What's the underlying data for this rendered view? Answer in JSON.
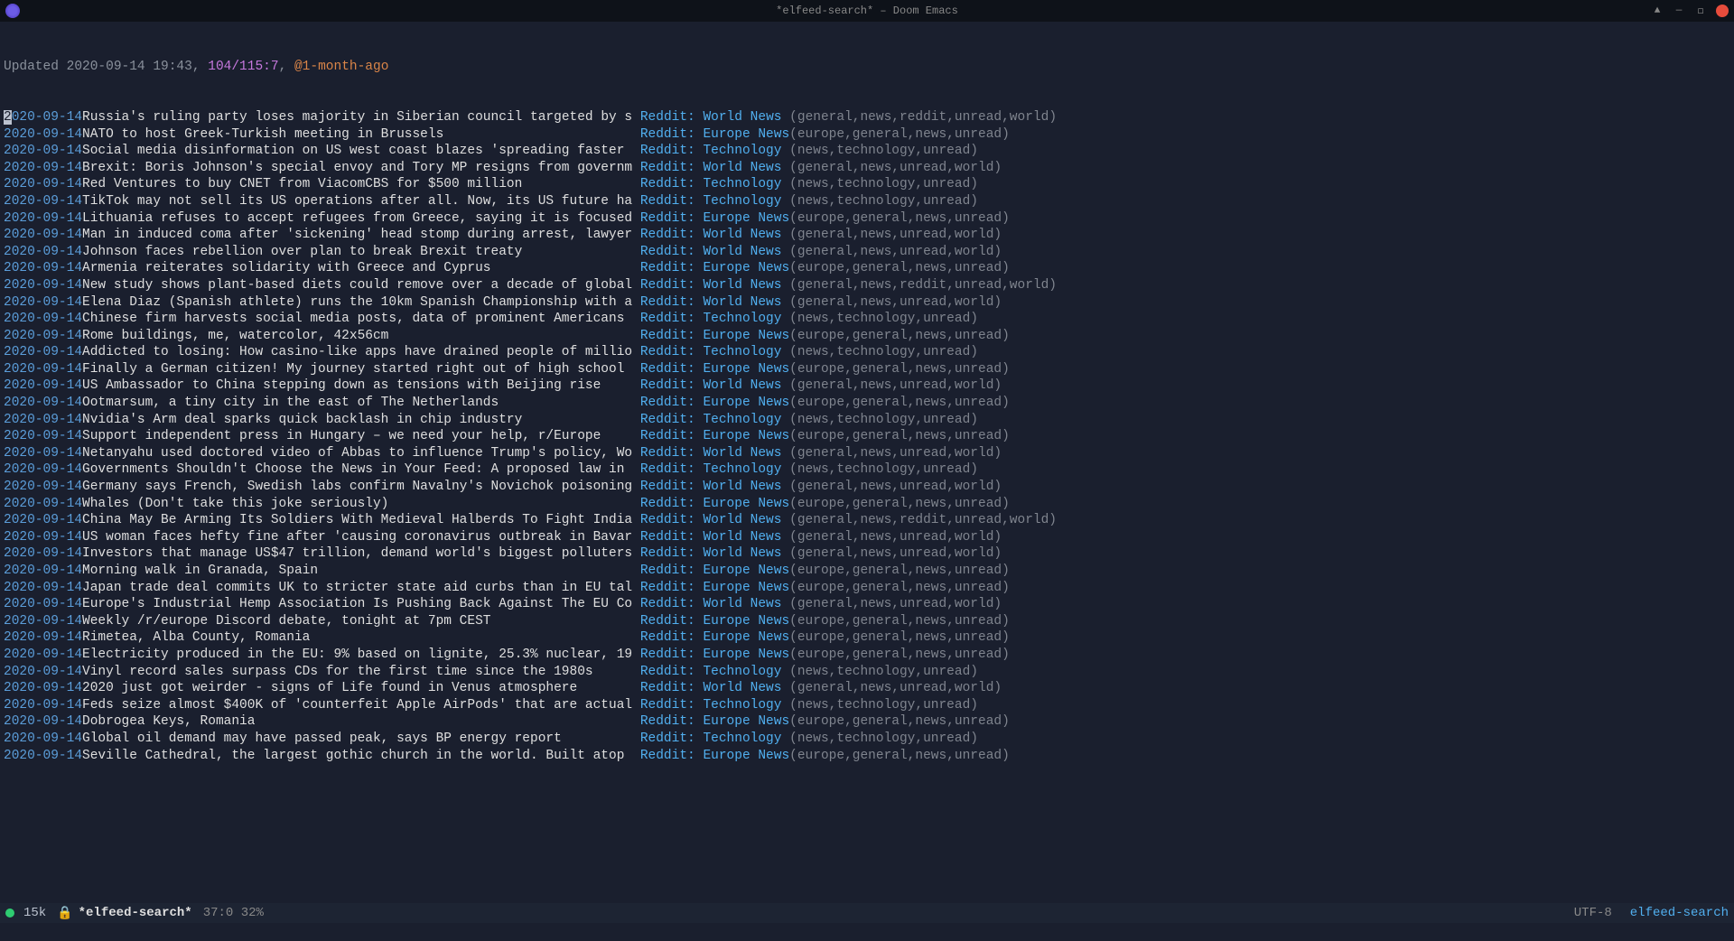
{
  "titlebar": {
    "title": "*elfeed-search* – Doom Emacs"
  },
  "header": {
    "updated": "Updated 2020-09-14 19:43, ",
    "count": "104/115:7",
    "sep": ", ",
    "filter": "@1-month-ago"
  },
  "feeds": {
    "world": "Reddit: World News",
    "europe": "Reddit: Europe News",
    "tech": "Reddit: Technology"
  },
  "tag_strings": {
    "world_reddit": "(general,news,reddit,unread,world)",
    "world": "(general,news,unread,world)",
    "europe": "(europe,general,news,unread)",
    "tech": "(news,technology,unread)"
  },
  "date": "2020-09-14",
  "entries": [
    {
      "cursor": true,
      "title": "Russia's ruling party loses majority in Siberian council targeted by s",
      "feed": "world",
      "tags": "world_reddit"
    },
    {
      "title": "NATO to host Greek-Turkish meeting in Brussels",
      "feed": "europe",
      "tags": "europe"
    },
    {
      "title": "Social media disinformation on US west coast blazes 'spreading faster",
      "feed": "tech",
      "tags": "tech"
    },
    {
      "title": "Brexit: Boris Johnson's special envoy and Tory MP resigns from governm",
      "feed": "world",
      "tags": "world"
    },
    {
      "title": "Red Ventures to buy CNET from ViacomCBS for $500 million",
      "feed": "tech",
      "tags": "tech"
    },
    {
      "title": "TikTok may not sell its US operations after all. Now, its US future ha",
      "feed": "tech",
      "tags": "tech"
    },
    {
      "title": "Lithuania refuses to accept refugees from Greece, saying it is focused",
      "feed": "europe",
      "tags": "europe"
    },
    {
      "title": "Man in induced coma after 'sickening' head stomp during arrest, lawyer",
      "feed": "world",
      "tags": "world"
    },
    {
      "title": "Johnson faces rebellion over plan to break Brexit treaty",
      "feed": "world",
      "tags": "world"
    },
    {
      "title": "Armenia reiterates solidarity with Greece and Cyprus",
      "feed": "europe",
      "tags": "europe"
    },
    {
      "title": "New study shows plant-based diets could remove over a decade of global",
      "feed": "world",
      "tags": "world_reddit"
    },
    {
      "title": "Elena Diaz (Spanish athlete) runs the 10km Spanish Championship with a",
      "feed": "world",
      "tags": "world"
    },
    {
      "title": "Chinese firm harvests social media posts, data of prominent Americans",
      "feed": "tech",
      "tags": "tech"
    },
    {
      "title": "Rome buildings, me, watercolor, 42x56cm",
      "feed": "europe",
      "tags": "europe"
    },
    {
      "title": "Addicted to losing: How casino-like apps have drained people of millio",
      "feed": "tech",
      "tags": "tech"
    },
    {
      "title": "Finally a German citizen! My journey started right out of high school",
      "feed": "europe",
      "tags": "europe"
    },
    {
      "title": "US Ambassador to China stepping down as tensions with Beijing rise",
      "feed": "world",
      "tags": "world"
    },
    {
      "title": "Ootmarsum, a tiny city in the east of The Netherlands",
      "feed": "europe",
      "tags": "europe"
    },
    {
      "title": "Nvidia's Arm deal sparks quick backlash in chip industry",
      "feed": "tech",
      "tags": "tech"
    },
    {
      "title": "Support independent press in Hungary – we need your help, r/Europe",
      "feed": "europe",
      "tags": "europe"
    },
    {
      "title": "Netanyahu used doctored video of Abbas to influence Trump's policy, Wo",
      "feed": "world",
      "tags": "world"
    },
    {
      "title": "Governments Shouldn't Choose the News in Your Feed: A proposed law in",
      "feed": "tech",
      "tags": "tech"
    },
    {
      "title": "Germany says French, Swedish labs confirm Navalny's Novichok poisoning",
      "feed": "world",
      "tags": "world"
    },
    {
      "title": "Whales (Don't take this joke seriously)",
      "feed": "europe",
      "tags": "europe"
    },
    {
      "title": "China May Be Arming Its Soldiers With Medieval Halberds To Fight India",
      "feed": "world",
      "tags": "world_reddit"
    },
    {
      "title": "US woman faces hefty fine after 'causing coronavirus outbreak in Bavar",
      "feed": "world",
      "tags": "world"
    },
    {
      "title": "Investors that manage US$47 trillion, demand world's biggest polluters",
      "feed": "world",
      "tags": "world"
    },
    {
      "title": "Morning walk in Granada, Spain",
      "feed": "europe",
      "tags": "europe"
    },
    {
      "title": "Japan trade deal commits UK to stricter state aid curbs than in EU tal",
      "feed": "europe",
      "tags": "europe"
    },
    {
      "title": "Europe's Industrial Hemp Association Is Pushing Back Against The EU Co",
      "feed": "world",
      "tags": "world"
    },
    {
      "title": "Weekly /r/europe Discord debate, tonight at 7pm CEST",
      "feed": "europe",
      "tags": "europe"
    },
    {
      "title": "Rimetea, Alba County, Romania",
      "feed": "europe",
      "tags": "europe"
    },
    {
      "title": "Electricity produced in the EU: 9% based on lignite, 25.3% nuclear, 19",
      "feed": "europe",
      "tags": "europe"
    },
    {
      "title": "Vinyl record sales surpass CDs for the first time since the 1980s",
      "feed": "tech",
      "tags": "tech"
    },
    {
      "title": "2020 just got weirder - signs of Life found in Venus atmosphere",
      "feed": "world",
      "tags": "world"
    },
    {
      "title": "Feds seize almost $400K of 'counterfeit Apple AirPods' that are actual",
      "feed": "tech",
      "tags": "tech"
    },
    {
      "title": "Dobrogea Keys, Romania",
      "feed": "europe",
      "tags": "europe"
    },
    {
      "title": "Global oil demand may have passed peak, says BP energy report",
      "feed": "tech",
      "tags": "tech"
    },
    {
      "title": "Seville Cathedral, the largest gothic church in the world. Built atop",
      "feed": "europe",
      "tags": "europe"
    }
  ],
  "modeline": {
    "size": "15k",
    "lock": "🔒",
    "buffer": "*elfeed-search*",
    "position": "37:0 32%",
    "encoding": "UTF-8",
    "mode": "elfeed-search"
  }
}
